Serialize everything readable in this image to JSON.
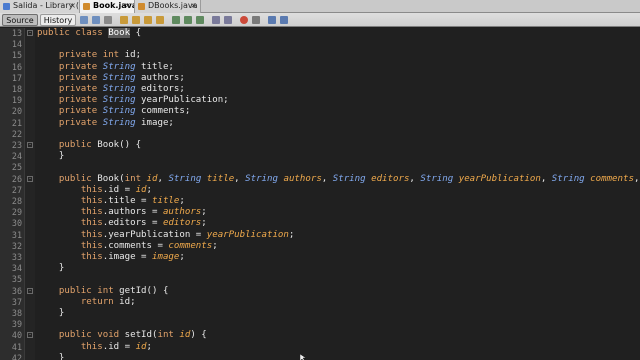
{
  "tabs": [
    {
      "label": "Salida - Library (run)",
      "icon_color": "#4a7bd0",
      "active": false
    },
    {
      "label": "Book.java",
      "icon_color": "#d08a2c",
      "active": true
    },
    {
      "label": "DBooks.java",
      "icon_color": "#d08a2c",
      "active": false
    }
  ],
  "tab_close_glyph": "×",
  "toolbar": {
    "source_label": "Source",
    "history_label": "History"
  },
  "editor": {
    "first_line_number": 13,
    "lines": [
      {
        "n": "13",
        "html": "<span class='kw'>public</span> <span class='kw'>class</span> <span class='sel'>Book</span> {"
      },
      {
        "n": "14",
        "html": ""
      },
      {
        "n": "15",
        "html": "    <span class='kw'>private</span> <span class='kw'>int</span> id;"
      },
      {
        "n": "16",
        "html": "    <span class='kw'>private</span> <span class='ty'>String</span> title;"
      },
      {
        "n": "17",
        "html": "    <span class='kw'>private</span> <span class='ty'>String</span> authors;"
      },
      {
        "n": "18",
        "html": "    <span class='kw'>private</span> <span class='ty'>String</span> editors;"
      },
      {
        "n": "19",
        "html": "    <span class='kw'>private</span> <span class='ty'>String</span> yearPublication;"
      },
      {
        "n": "20",
        "html": "    <span class='kw'>private</span> <span class='ty'>String</span> comments;"
      },
      {
        "n": "21",
        "html": "    <span class='kw'>private</span> <span class='ty'>String</span> image;"
      },
      {
        "n": "22",
        "html": ""
      },
      {
        "n": "23",
        "html": "    <span class='kw'>public</span> Book() {"
      },
      {
        "n": "24",
        "html": "    }"
      },
      {
        "n": "25",
        "html": ""
      },
      {
        "n": "26",
        "html": "    <span class='kw'>public</span> Book(<span class='kw'>int</span> <span class='pa'>id</span>, <span class='ty'>String</span> <span class='pa'>title</span>, <span class='ty'>String</span> <span class='pa'>authors</span>, <span class='ty'>String</span> <span class='pa'>editors</span>, <span class='ty'>String</span> <span class='pa'>yearPublication</span>, <span class='ty'>String</span> <span class='pa'>comments</span>, <span class='ty'>String</span> <span class='pa'>image</span>) {"
      },
      {
        "n": "27",
        "html": "        <span class='th'>this</span>.id = <span class='pa'>id</span>;"
      },
      {
        "n": "28",
        "html": "        <span class='th'>this</span>.title = <span class='pa'>title</span>;"
      },
      {
        "n": "29",
        "html": "        <span class='th'>this</span>.authors = <span class='pa'>authors</span>;"
      },
      {
        "n": "30",
        "html": "        <span class='th'>this</span>.editors = <span class='pa'>editors</span>;"
      },
      {
        "n": "31",
        "html": "        <span class='th'>this</span>.yearPublication = <span class='pa'>yearPublication</span>;"
      },
      {
        "n": "32",
        "html": "        <span class='th'>this</span>.comments = <span class='pa'>comments</span>;"
      },
      {
        "n": "33",
        "html": "        <span class='th'>this</span>.image = <span class='pa'>image</span>;"
      },
      {
        "n": "34",
        "html": "    }"
      },
      {
        "n": "35",
        "html": ""
      },
      {
        "n": "36",
        "html": "    <span class='kw'>public</span> <span class='kw'>int</span> getId() {"
      },
      {
        "n": "37",
        "html": "        <span class='kw'>return</span> id;"
      },
      {
        "n": "38",
        "html": "    }"
      },
      {
        "n": "39",
        "html": ""
      },
      {
        "n": "40",
        "html": "    <span class='kw'>public</span> <span class='kw'>void</span> setId(<span class='kw'>int</span> <span class='pa'>id</span>) {"
      },
      {
        "n": "41",
        "html": "        <span class='th'>this</span>.id = <span class='pa'>id</span>;"
      },
      {
        "n": "42",
        "html": "    }"
      }
    ],
    "folds": [
      "13",
      "23",
      "26",
      "36",
      "40"
    ]
  },
  "colors": {
    "keyword": "#e3a36b",
    "type": "#82aaf0",
    "parameter": "#f0aa4c",
    "background": "#202020"
  }
}
